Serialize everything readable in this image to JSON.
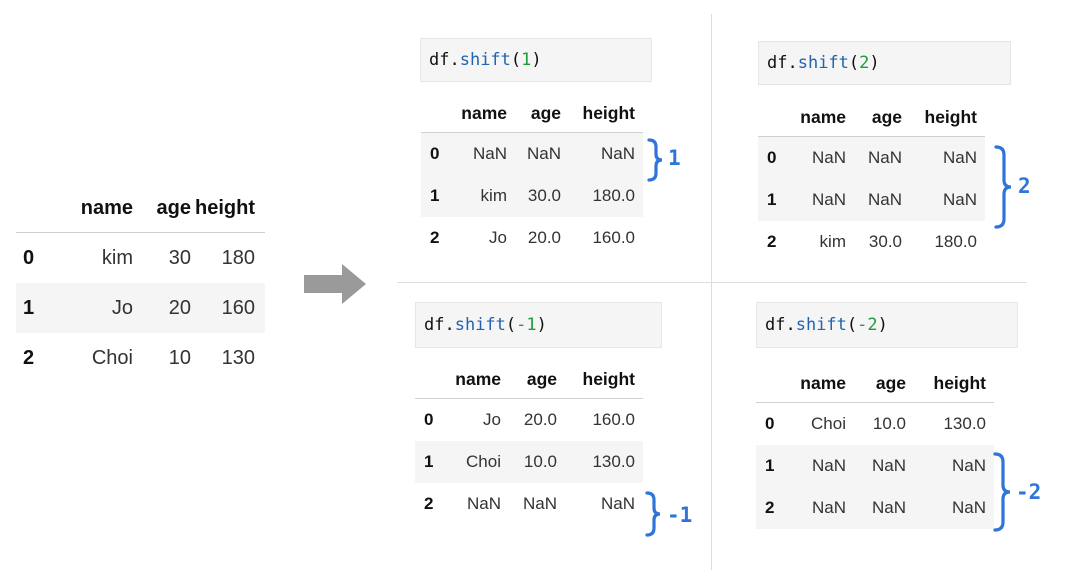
{
  "original": {
    "columns": [
      "name",
      "age",
      "height"
    ],
    "rows": [
      {
        "index": "0",
        "name": "kim",
        "age": "30",
        "height": "180"
      },
      {
        "index": "1",
        "name": "Jo",
        "age": "20",
        "height": "160"
      },
      {
        "index": "2",
        "name": "Choi",
        "age": "10",
        "height": "130"
      }
    ]
  },
  "panels": [
    {
      "code": {
        "obj": "df.",
        "fn": "shift",
        "open": "(",
        "arg": "1",
        "close": ")"
      },
      "columns": [
        "name",
        "age",
        "height"
      ],
      "rows": [
        {
          "index": "0",
          "name": "NaN",
          "age": "NaN",
          "height": "NaN"
        },
        {
          "index": "1",
          "name": "kim",
          "age": "30.0",
          "height": "180.0"
        },
        {
          "index": "2",
          "name": "Jo",
          "age": "20.0",
          "height": "160.0"
        }
      ],
      "brace_label": "1"
    },
    {
      "code": {
        "obj": "df.",
        "fn": "shift",
        "open": "(",
        "arg": "2",
        "close": ")"
      },
      "columns": [
        "name",
        "age",
        "height"
      ],
      "rows": [
        {
          "index": "0",
          "name": "NaN",
          "age": "NaN",
          "height": "NaN"
        },
        {
          "index": "1",
          "name": "NaN",
          "age": "NaN",
          "height": "NaN"
        },
        {
          "index": "2",
          "name": "kim",
          "age": "30.0",
          "height": "180.0"
        }
      ],
      "brace_label": "2"
    },
    {
      "code": {
        "obj": "df.",
        "fn": "shift",
        "open": "(",
        "arg": "-1",
        "close": ")"
      },
      "columns": [
        "name",
        "age",
        "height"
      ],
      "rows": [
        {
          "index": "0",
          "name": "Jo",
          "age": "20.0",
          "height": "160.0"
        },
        {
          "index": "1",
          "name": "Choi",
          "age": "10.0",
          "height": "130.0"
        },
        {
          "index": "2",
          "name": "NaN",
          "age": "NaN",
          "height": "NaN"
        }
      ],
      "brace_label": "-1"
    },
    {
      "code": {
        "obj": "df.",
        "fn": "shift",
        "open": "(",
        "arg": "-2",
        "close": ")"
      },
      "columns": [
        "name",
        "age",
        "height"
      ],
      "rows": [
        {
          "index": "0",
          "name": "Choi",
          "age": "10.0",
          "height": "130.0"
        },
        {
          "index": "1",
          "name": "NaN",
          "age": "NaN",
          "height": "NaN"
        },
        {
          "index": "2",
          "name": "NaN",
          "age": "NaN",
          "height": "NaN"
        }
      ],
      "brace_label": "-2"
    }
  ],
  "arrow_icon": "right-arrow-icon",
  "colors": {
    "accent_brace": "#2f74d8",
    "code_function": "#2164b0",
    "code_number": "#1f9b3a",
    "arrow": "#9a9a9a"
  }
}
